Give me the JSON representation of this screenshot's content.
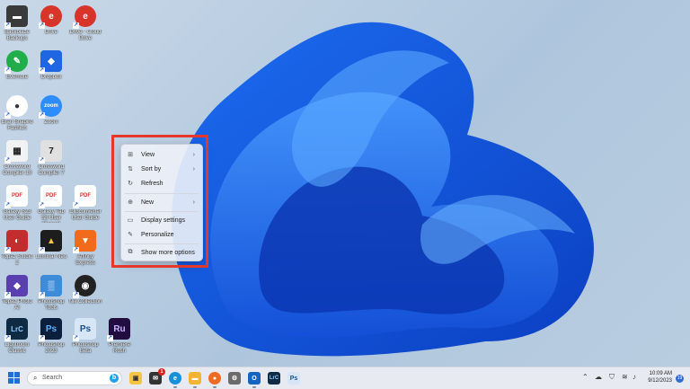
{
  "desktop": {
    "icons": [
      {
        "label": "Backblaze Backups",
        "glyph": "▬",
        "bg": "#3a3a3a"
      },
      {
        "label": "Drive",
        "glyph": "e",
        "bg": "#d7342a"
      },
      {
        "label": "Drive - Cloud Drive",
        "glyph": "e",
        "bg": "#d7342a"
      },
      {
        "label": "Evernote",
        "glyph": "✎",
        "bg": "#1fae4a"
      },
      {
        "label": "Dropbox",
        "glyph": "◆",
        "bg": "#1e66e2"
      },
      {
        "label": "Eran Shapiro Fashion",
        "glyph": "●",
        "bg": "#ffffff"
      },
      {
        "label": "Zoom",
        "glyph": "zoom",
        "bg": "#2d8cff"
      },
      {
        "label": "Crossword Compiler 10",
        "glyph": "▦",
        "bg": "#f2f2f2"
      },
      {
        "label": "Crossword Compiler 7",
        "glyph": "7",
        "bg": "#e0e0e0"
      },
      {
        "label": "Galaxy S23 User Guide",
        "glyph": "PDF",
        "bg": "#ffffff"
      },
      {
        "label": "Galaxy Tab S8 User Manual",
        "glyph": "PDF",
        "bg": "#ffffff"
      },
      {
        "label": "Clipconverter User Guide",
        "glyph": "PDF",
        "bg": "#ffffff"
      },
      {
        "label": "Topaz Studio 2",
        "glyph": "◐",
        "bg": "#c42d2d"
      },
      {
        "label": "Luminar Neo",
        "glyph": "▲",
        "bg": "#1d1d1d"
      },
      {
        "label": "Affinity Express",
        "glyph": "▼",
        "bg": "#f26b1d"
      },
      {
        "label": "Topaz Photo AI",
        "glyph": "◆",
        "bg": "#5a3fb0"
      },
      {
        "label": "Photoshop Tools",
        "glyph": "▒",
        "bg": "#3d8bd9"
      },
      {
        "label": "Nik Collection",
        "glyph": "◉",
        "bg": "#222222"
      },
      {
        "label": "Lightroom Classic",
        "glyph": "LrC",
        "bg": "#0f2b44"
      },
      {
        "label": "Photoshop 2023",
        "glyph": "Ps",
        "bg": "#0b1e3b"
      },
      {
        "label": "Photoshop Beta",
        "glyph": "Ps",
        "bg": "#d6e6f7"
      },
      {
        "label": "Premiere Rush",
        "glyph": "Ru",
        "bg": "#220d41"
      }
    ]
  },
  "context_menu": {
    "items": [
      {
        "label": "View",
        "icon": "grid-icon",
        "glyph": "⊞",
        "submenu": true
      },
      {
        "label": "Sort by",
        "icon": "sort-icon",
        "glyph": "⇅",
        "submenu": true
      },
      {
        "label": "Refresh",
        "icon": "refresh-icon",
        "glyph": "↻",
        "submenu": false
      },
      {
        "label": "New",
        "icon": "new-icon",
        "glyph": "⊕",
        "submenu": true
      },
      {
        "label": "Display settings",
        "icon": "display-icon",
        "glyph": "▭",
        "submenu": false
      },
      {
        "label": "Personalize",
        "icon": "brush-icon",
        "glyph": "✎",
        "submenu": false
      },
      {
        "label": "Show more options",
        "icon": "more-options-icon",
        "glyph": "⧉",
        "submenu": false
      }
    ],
    "highlight_color": "#e5372c"
  },
  "taskbar": {
    "search_placeholder": "Search",
    "search_glyph": "⌕",
    "bing_glyph": "b",
    "mail_badge": "1",
    "apps": [
      {
        "name": "file-explorer",
        "glyph": "▣",
        "bg": "#f4c542"
      },
      {
        "name": "mail",
        "glyph": "✉",
        "bg": "#333333"
      },
      {
        "name": "edge",
        "glyph": "e",
        "bg": "#1a8fd9"
      },
      {
        "name": "folder",
        "glyph": "▬",
        "bg": "#f2b531"
      },
      {
        "name": "firefox",
        "glyph": "●",
        "bg": "#f06a23"
      },
      {
        "name": "settings",
        "glyph": "⚙",
        "bg": "#6b6b6b"
      },
      {
        "name": "outlook",
        "glyph": "O",
        "bg": "#1565c0"
      },
      {
        "name": "lightroom-classic",
        "glyph": "LrC",
        "bg": "#0f2b44"
      },
      {
        "name": "photoshop",
        "glyph": "Ps",
        "bg": "#d6e6f7"
      }
    ],
    "time": "10:09 AM",
    "date": "9/12/2023",
    "notifications": "19"
  }
}
